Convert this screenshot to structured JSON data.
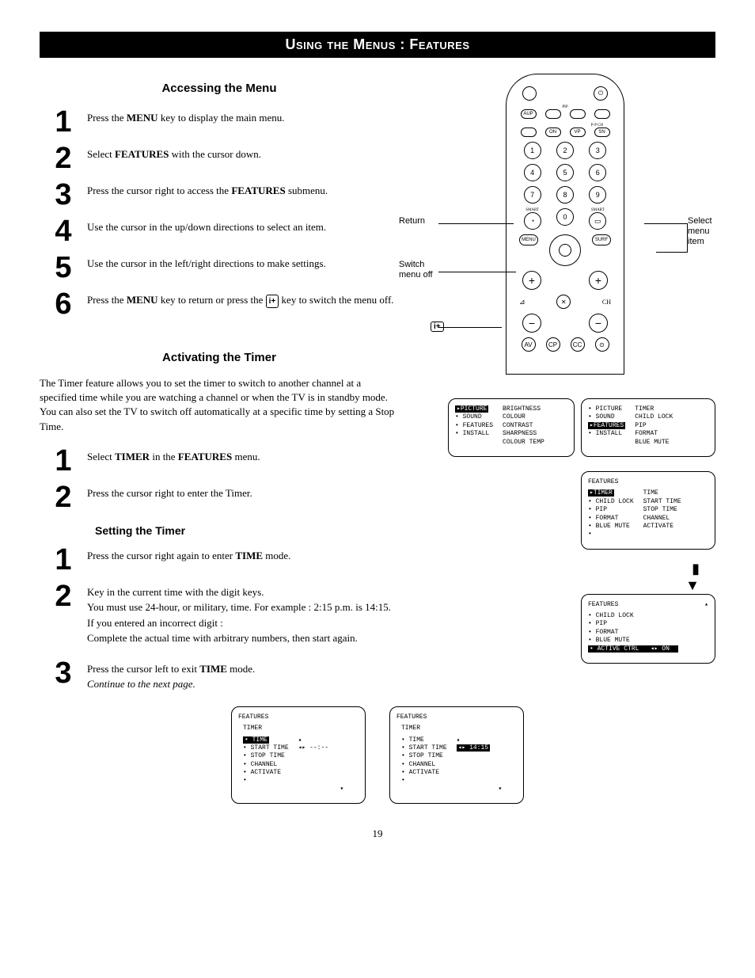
{
  "banner": "Using the Menus : Features",
  "sectionA": {
    "heading": "Accessing the Menu",
    "steps": [
      "Press the <b>MENU</b> key to display the main menu.",
      "Select <b>FEATURES</b> with the cursor down.",
      "Press the cursor right to access the <b>FEATURES</b> submenu.",
      "Use the cursor in the up/down directions to select an item.",
      "Use the cursor in the left/right directions to make settings.",
      "Press the <b>MENU</b> key to return or press the <span class='info-icon'>i+</span> key to switch the menu off."
    ]
  },
  "sectionB": {
    "heading": "Activating the Timer",
    "intro": "The Timer feature allows you to set the timer to switch to another channel at a specified time while you are watching a channel or when the TV is in standby mode. You can also set the TV to switch off automatically at a specific time by setting a Stop Time.",
    "steps": [
      "Select <b>TIMER</b> in the <b>FEATURES</b> menu.",
      "Press the cursor right to enter the Timer."
    ]
  },
  "sectionC": {
    "heading": "Setting the Timer",
    "steps": [
      "Press the cursor right again to enter <b>TIME</b> mode.",
      "Key in the current time with the digit keys.<br>You must use 24-hour, or military, time. For example : 2:15 p.m. is 14:15.<br>If you entered an incorrect digit :<br>Complete the actual time with arbitrary numbers, then start again.",
      "Press the cursor left to exit <b>TIME</b> mode.<br><i>Continue to the next page.</i>"
    ]
  },
  "remote": {
    "labels": {
      "return": "Return",
      "switch": "Switch menu off",
      "select": "Select menu item"
    },
    "digits": [
      "1",
      "2",
      "3",
      "4",
      "5",
      "6",
      "7",
      "8",
      "9",
      "0"
    ],
    "menu": "MENU",
    "surf": "SURF",
    "smart1": "SMART",
    "smart2": "SMART",
    "pip": "PIP",
    "ppch": "P-P CH",
    "ch": "CH",
    "info": "i+",
    "bottom": [
      "AV",
      "CP",
      "CC",
      "⊙"
    ]
  },
  "osd1": {
    "left": [
      "PICTURE",
      "SOUND",
      "FEATURES",
      "INSTALL"
    ],
    "right": [
      "BRIGHTNESS",
      "COLOUR",
      "CONTRAST",
      "SHARPNESS",
      "COLOUR TEMP"
    ],
    "highlight": "PICTURE"
  },
  "osd2": {
    "left": [
      "PICTURE",
      "SOUND",
      "FEATURES",
      "INSTALL"
    ],
    "right": [
      "TIMER",
      "CHILD LOCK",
      "PIP",
      "FORMAT",
      "BLUE MUTE"
    ],
    "highlight": "FEATURES"
  },
  "osd3": {
    "title": "FEATURES",
    "left": [
      "TIMER",
      "CHILD LOCK",
      "PIP",
      "FORMAT",
      "BLUE MUTE",
      ""
    ],
    "right": [
      "TIME",
      "START TIME",
      "STOP TIME",
      "CHANNEL",
      "ACTIVATE"
    ],
    "highlight": "TIMER"
  },
  "osd4": {
    "title": "FEATURES",
    "left": [
      "CHILD LOCK",
      "PIP",
      "FORMAT",
      "BLUE MUTE",
      "ACTIVE CTRL"
    ],
    "right_val": "ON",
    "highlight": "ACTIVE CTRL",
    "marker": "▴"
  },
  "osd5": {
    "title": "FEATURES",
    "subtitle": "TIMER",
    "left": [
      "TIME",
      "START TIME",
      "STOP TIME",
      "CHANNEL",
      "ACTIVATE",
      ""
    ],
    "value": "--:--",
    "highlight": "TIME"
  },
  "osd6": {
    "title": "FEATURES",
    "subtitle": "TIMER",
    "left": [
      "TIME",
      "START TIME",
      "STOP TIME",
      "CHANNEL",
      "ACTIVATE",
      ""
    ],
    "value": "14:15"
  },
  "pagenum": "19"
}
